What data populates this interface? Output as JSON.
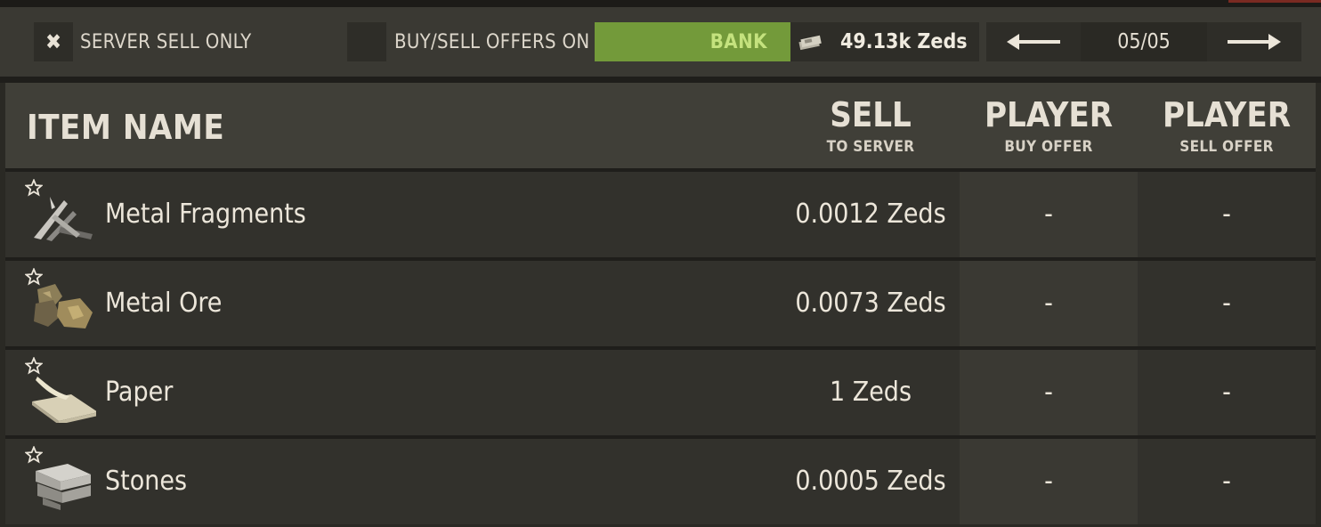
{
  "toolbar": {
    "server_sell_only_label": "SERVER SELL ONLY",
    "server_sell_only_checked": true,
    "buy_sell_offers_label": "BUY/SELL OFFERS ON",
    "buy_sell_offers_checked": false,
    "bank_label": "BANK",
    "balance": "49.13k Zeds",
    "page": "05/05",
    "icons": {
      "checkbox_mark": "x-mark-icon",
      "money": "money-stack-icon",
      "prev": "arrow-left-icon",
      "next": "arrow-right-icon"
    },
    "colors": {
      "bank_bg": "#739a3a",
      "bank_text": "#c4e27e"
    }
  },
  "table": {
    "columns": {
      "item_name": "ITEM NAME",
      "sell": {
        "title": "SELL",
        "subtitle": "TO SERVER"
      },
      "player_buy": {
        "title": "PLAYER",
        "subtitle": "BUY OFFER"
      },
      "player_sell": {
        "title": "PLAYER",
        "subtitle": "SELL OFFER"
      }
    },
    "rows": [
      {
        "name": "Metal Fragments",
        "sell_to_server": "0.0012 Zeds",
        "player_buy_offer": "-",
        "player_sell_offer": "-",
        "icon": "metal-fragments-icon",
        "favorite": false
      },
      {
        "name": "Metal Ore",
        "sell_to_server": "0.0073 Zeds",
        "player_buy_offer": "-",
        "player_sell_offer": "-",
        "icon": "metal-ore-icon",
        "favorite": false
      },
      {
        "name": "Paper",
        "sell_to_server": "1 Zeds",
        "player_buy_offer": "-",
        "player_sell_offer": "-",
        "icon": "paper-icon",
        "favorite": false
      },
      {
        "name": "Stones",
        "sell_to_server": "0.0005 Zeds",
        "player_buy_offer": "-",
        "player_sell_offer": "-",
        "icon": "stones-icon",
        "favorite": false
      }
    ]
  }
}
